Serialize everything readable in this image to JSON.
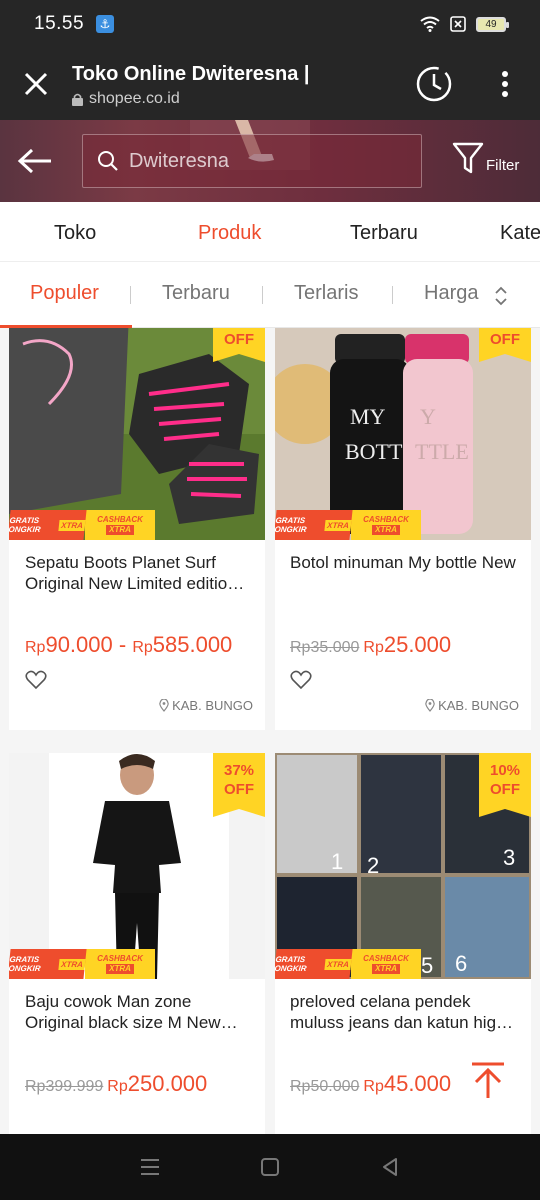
{
  "status": {
    "time": "15.55",
    "battery": "49"
  },
  "browser": {
    "title": "Toko Online Dwiteresna |",
    "url": "shopee.co.id"
  },
  "search": {
    "placeholder": "Dwiteresna",
    "filter_label": "Filter"
  },
  "shop_tabs": [
    "Toko",
    "Produk",
    "Terbaru",
    "Kate"
  ],
  "sort_tabs": [
    "Populer",
    "Terbaru",
    "Terlaris",
    "Harga"
  ],
  "badges": {
    "gratis": "GRATIS ONGKIR",
    "xtra": "XTRA",
    "cashback": "CASHBACK"
  },
  "products": [
    {
      "name": "Sepatu Boots Planet Surf Original New Limited edition …",
      "discount": "OFF",
      "price_orig": "",
      "price_rp1": "Rp",
      "price_low": "90.000",
      "price_sep": " - ",
      "price_rp2": "Rp",
      "price_high": "585.000",
      "location": "KAB. BUNGO"
    },
    {
      "name": "Botol minuman My bottle New",
      "discount": "OFF",
      "price_orig": "Rp35.000",
      "price_rp1": "Rp",
      "price_low": "25.000",
      "location": "KAB. BUNGO"
    },
    {
      "name": "Baju cowok Man zone Original black size M New Free …",
      "discount_pct": "37%",
      "discount": "OFF",
      "price_orig": "Rp399.999",
      "price_rp1": "Rp",
      "price_low": "250.000"
    },
    {
      "name": "preloved celana pendek muluss jeans dan katun high …",
      "discount_pct": "10%",
      "discount": "OFF",
      "price_orig": "Rp50.000",
      "price_rp1": "Rp",
      "price_low": "45.000",
      "photo_numbers": [
        "1",
        "2",
        "3",
        "5",
        "6"
      ]
    }
  ],
  "colors": {
    "accent": "#ee4d2d",
    "badge_yellow": "#ffd424"
  }
}
